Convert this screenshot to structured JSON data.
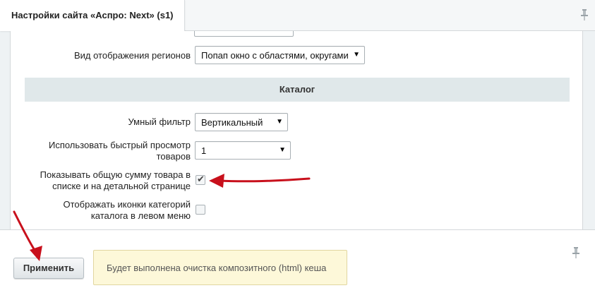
{
  "header": {
    "title": "Настройки сайта «Аспро: Next» (s1)",
    "pin_icon": "pin-icon"
  },
  "form": {
    "region_display_label": "Вид отображения регионов",
    "region_display_value": "Попап окно с областями, округами",
    "catalog_section_title": "Каталог",
    "smart_filter_label": "Умный фильтр",
    "smart_filter_value": "Вертикальный",
    "quick_view_label_line1": "Использовать быстрый просмотр",
    "quick_view_label_line2": "товаров",
    "quick_view_value": "1",
    "total_sum_label_line1": "Показывать общую сумму товара в",
    "total_sum_label_line2": "списке и на детальной странице",
    "total_sum_checked": true,
    "category_icons_label_line1": "Отображать иконки категорий",
    "category_icons_label_line2": "каталога в левом меню",
    "category_icons_checked": false
  },
  "footer": {
    "apply_label": "Применить",
    "notice_text": "Будет выполнена очистка композитного (html) кеша",
    "pin_icon": "pin-icon"
  },
  "colors": {
    "annotation_arrow": "#c8101c",
    "notice_bg": "#fdf8d9",
    "section_bg": "#e0e8ea"
  }
}
